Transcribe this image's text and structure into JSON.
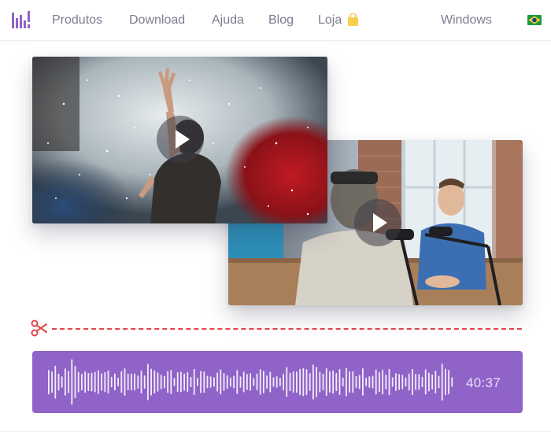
{
  "nav": {
    "logo_icon": "brand-bars-icon",
    "items": [
      {
        "label": "Produtos"
      },
      {
        "label": "Download"
      },
      {
        "label": "Ajuda"
      },
      {
        "label": "Blog"
      },
      {
        "label": "Loja",
        "icon": "shopping-bag-icon"
      }
    ],
    "platform": "Windows",
    "language_flag_icon": "brazil-flag-icon"
  },
  "media": {
    "concert_play_icon": "play-icon",
    "podcast_play_icon": "play-icon"
  },
  "cut": {
    "icon": "scissors-icon",
    "line_color": "#e2454a"
  },
  "audio": {
    "duration": "40:37",
    "track_color": "#8f63c7"
  },
  "colors": {
    "accent": "#8f63c7",
    "nav_text": "#7b7b8f"
  }
}
